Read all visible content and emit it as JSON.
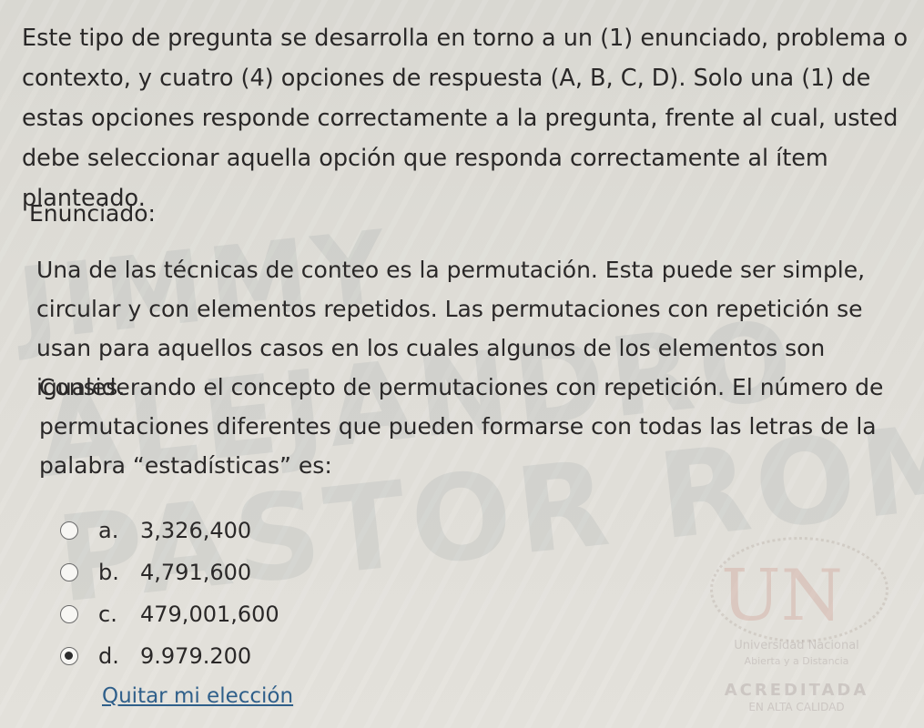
{
  "instructions": "Este tipo de pregunta se desarrolla en torno a un (1) enunciado, problema o contexto, y cuatro (4) opciones de respuesta (A, B, C, D). Solo una (1) de estas opciones responde correctamente a la pregunta, frente al cual, usted debe seleccionar aquella opción que responda correctamente al ítem planteado.",
  "enunciado_label": "Enunciado:",
  "stem_paragraph_1": "Una de las técnicas de conteo es la permutación. Esta puede ser simple, circular y con elementos repetidos. Las permutaciones con repetición se usan para aquellos casos en los cuales algunos de los elementos son iguales.",
  "stem_paragraph_2": "Considerando el concepto de permutaciones con repetición. El número de permutaciones diferentes que pueden formarse con todas las letras de la palabra “estadísticas” es:",
  "options": [
    {
      "letter": "a.",
      "text": "3,326,400",
      "selected": false
    },
    {
      "letter": "b.",
      "text": "4,791,600",
      "selected": false
    },
    {
      "letter": "c.",
      "text": "479,001,600",
      "selected": false
    },
    {
      "letter": "d.",
      "text": "9.979.200",
      "selected": true
    }
  ],
  "clear_choice_label": "Quitar mi elección",
  "watermark": {
    "line1": "JIMMY",
    "line2": "ALEJANDRO",
    "line3": "PASTOR ROMERO"
  },
  "logo": {
    "mark": "UN",
    "line1": "Universidad Nacional",
    "line2": "Abierta y a Distancia",
    "line3": "ACREDITADA",
    "line4": "EN ALTA CALIDAD"
  }
}
